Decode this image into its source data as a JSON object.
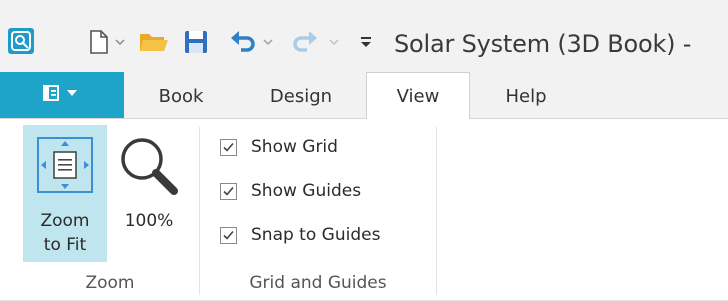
{
  "window": {
    "title": "Solar System (3D Book) -"
  },
  "quick_access": {
    "new_icon": "new-document-icon",
    "open_icon": "open-folder-icon",
    "save_icon": "save-icon",
    "undo_icon": "undo-icon",
    "redo_icon": "redo-icon",
    "customize_icon": "customize-toolbar-icon"
  },
  "ribbon_tabs": {
    "file_menu_icon": "app-menu-icon",
    "tabs": [
      {
        "label": "Book"
      },
      {
        "label": "Design"
      },
      {
        "label": "View",
        "active": true
      },
      {
        "label": "Help"
      }
    ]
  },
  "zoom_group": {
    "label": "Zoom",
    "zoom_to_fit": {
      "line1": "Zoom",
      "line2": "to Fit"
    },
    "zoom_100": {
      "label": "100%"
    }
  },
  "grid_group": {
    "label": "Grid and Guides",
    "show_grid": {
      "label": "Show Grid",
      "checked": true
    },
    "show_guides": {
      "label": "Show Guides",
      "checked": true
    },
    "snap_to_guides": {
      "label": "Snap to Guides",
      "checked": true
    }
  },
  "colors": {
    "accent": "#1ea3c9",
    "selected_button_bg": "#bfe5ef",
    "save_blue": "#2f6fbd",
    "folder_yellow": "#f5c245",
    "undo_blue": "#2f80c9"
  }
}
